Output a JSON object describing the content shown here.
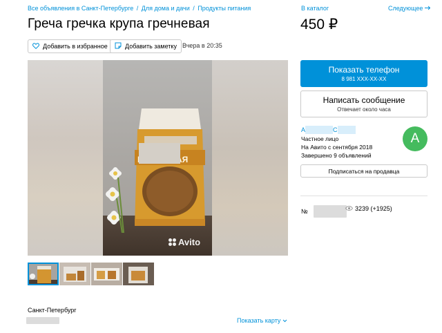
{
  "breadcrumb": {
    "items": [
      "Все объявления в Санкт-Петербурге",
      "Для дома и дачи",
      "Продукты питания"
    ],
    "separator": "/"
  },
  "title": "Греча гречка крупа гречневая",
  "actions": {
    "favorite_label": "Добавить в избранное",
    "note_label": "Добавить заметку",
    "date": "Вчера в 20:35"
  },
  "gallery": {
    "watermark": "Avito",
    "package_text": "ГРЕЧНЕВАЯ",
    "thumbnail_count": 4
  },
  "location": {
    "city": "Санкт-Петербург",
    "show_map_label": "Показать карту"
  },
  "sidebar": {
    "catalog_link": "В каталог",
    "next_link": "Следующее",
    "price": "450 ₽",
    "phone_button": {
      "label": "Показать телефон",
      "number": "8 981 XXX-XX-XX"
    },
    "message_button": {
      "label": "Написать сообщение",
      "sub": "Отвечает около часа"
    },
    "seller": {
      "name_start": "А",
      "name_mid": "С",
      "type": "Частное лицо",
      "since": "На Авито с сентября 2018",
      "completed": "Завершено 9 объявлений",
      "avatar_letter": "А"
    },
    "subscribe_label": "Подписаться на продавца",
    "item_number_prefix": "№",
    "views": "3239 (+1925)"
  },
  "colors": {
    "accent": "#0091d9",
    "avatar": "#45bb5e",
    "border": "#c9c9c9"
  }
}
